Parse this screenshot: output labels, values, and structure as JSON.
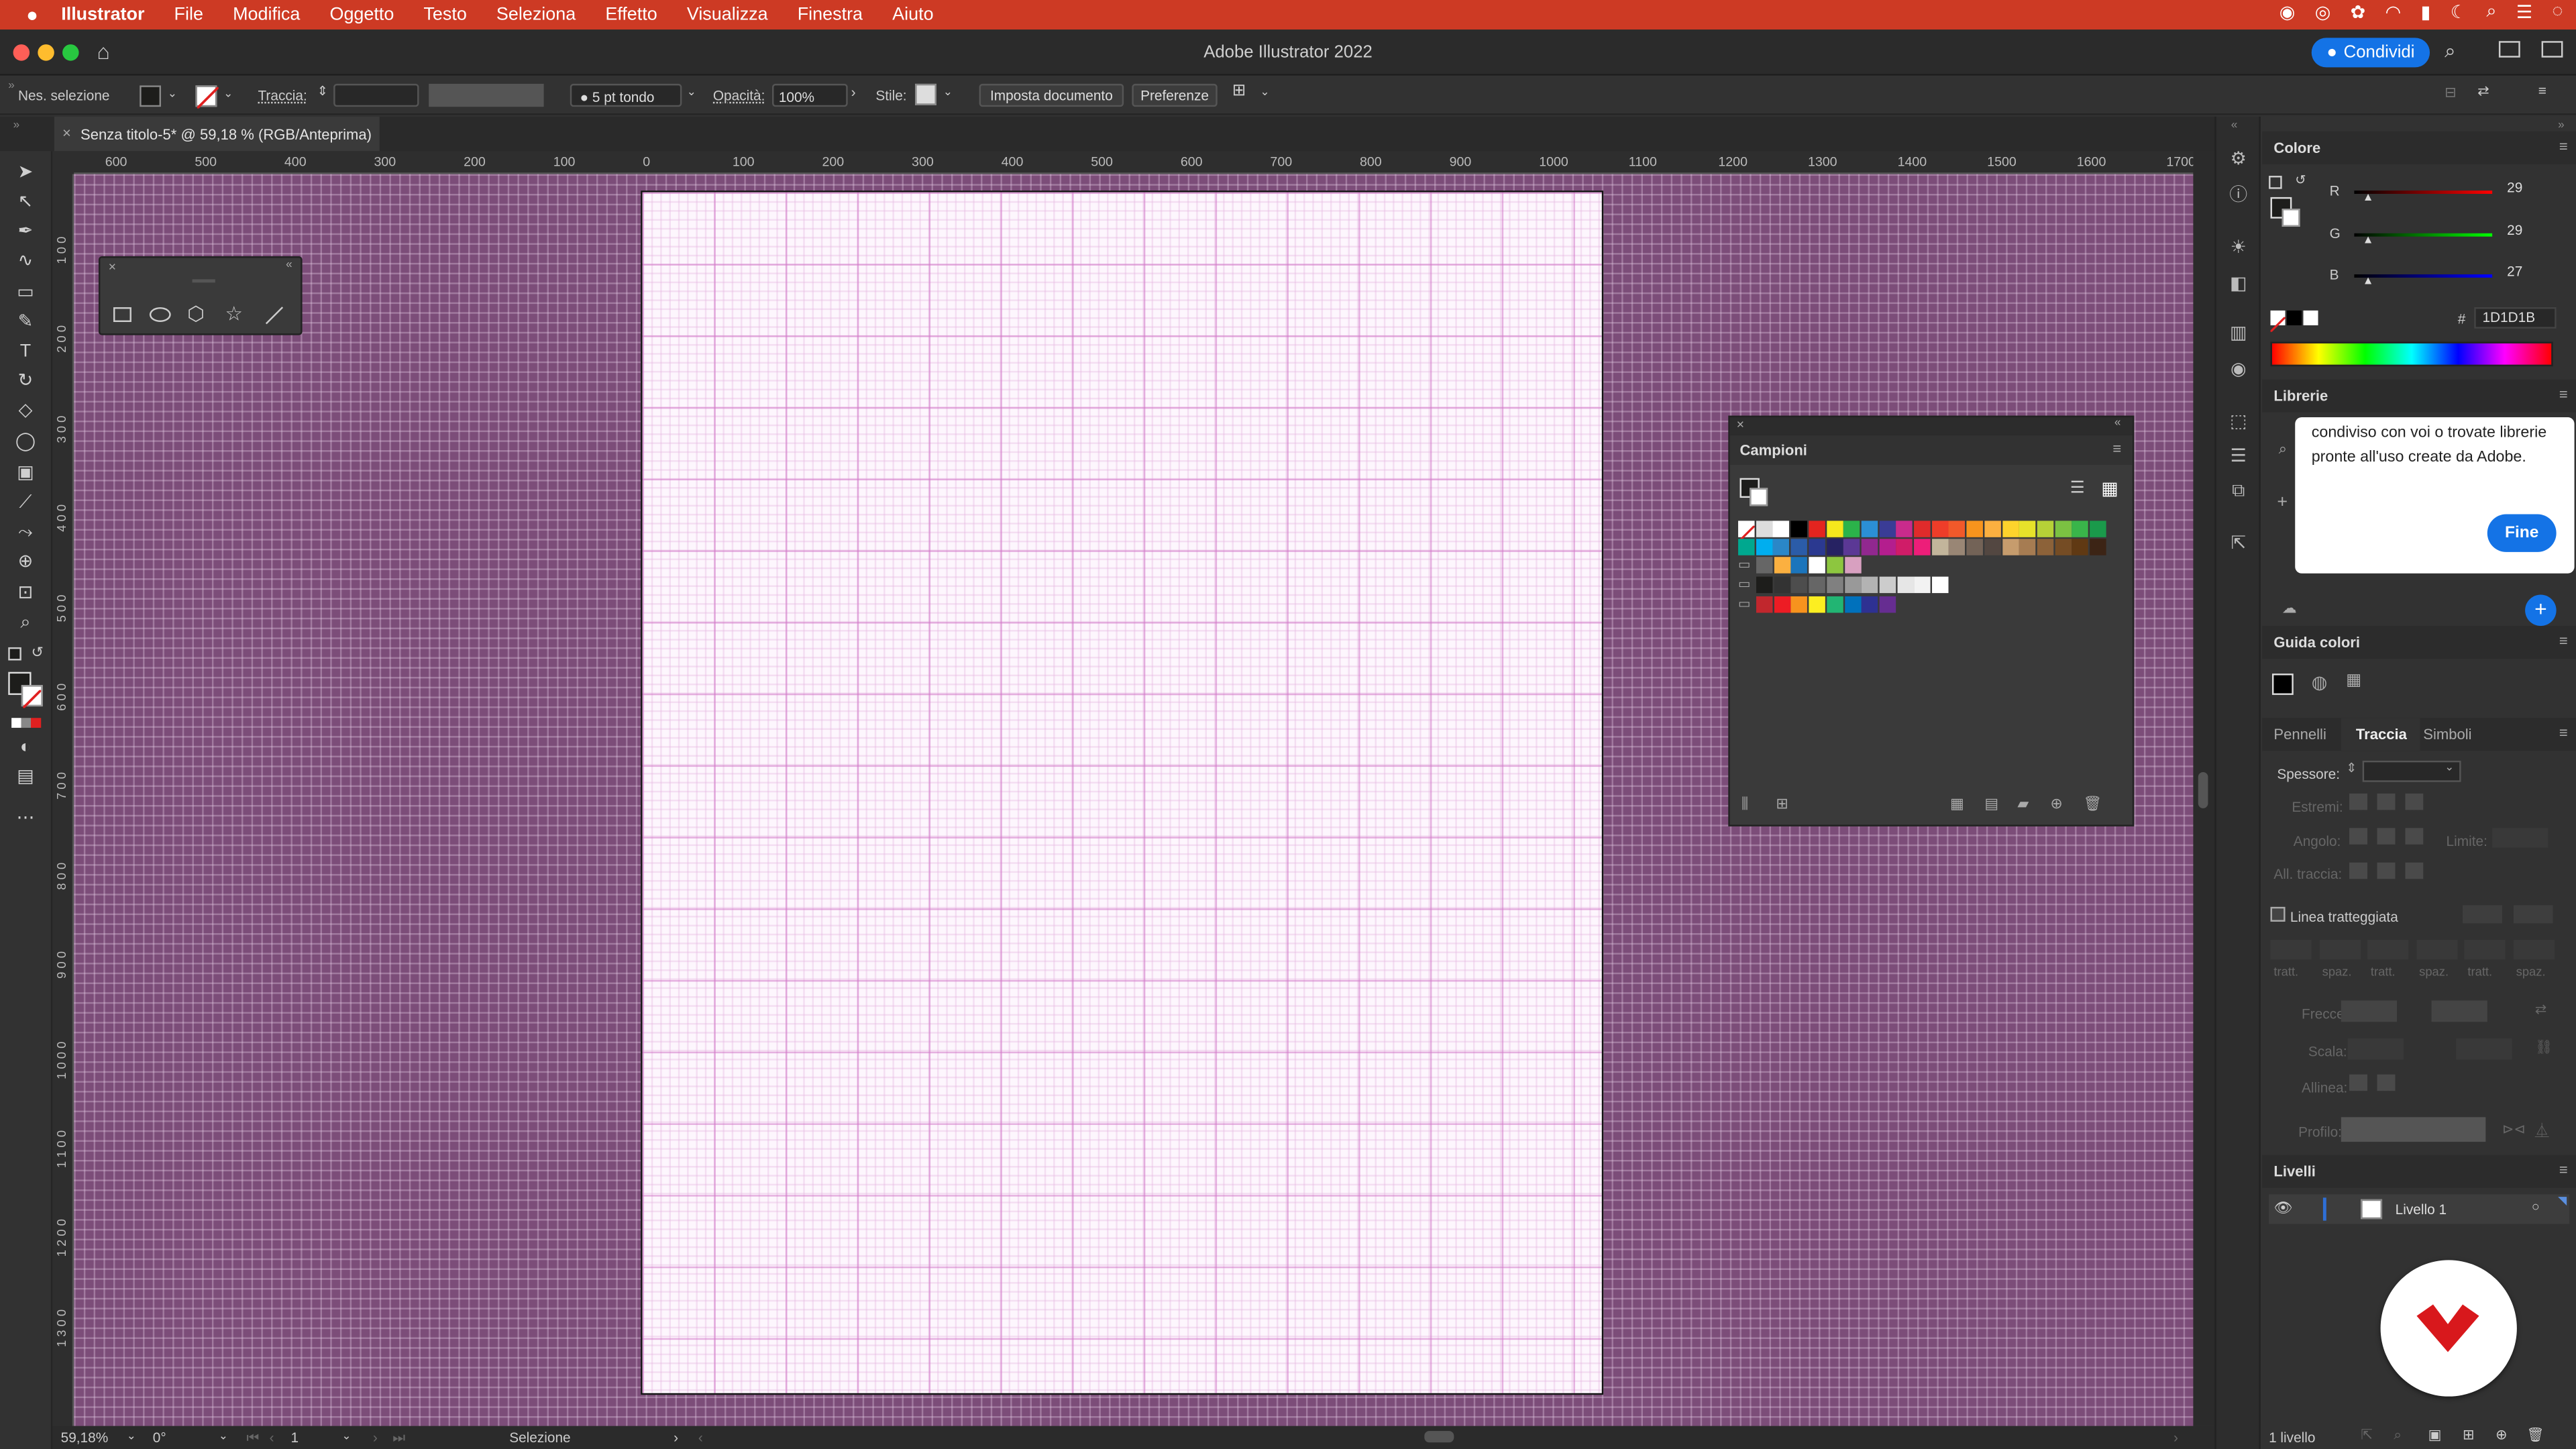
{
  "menubar": {
    "apple": "",
    "app": "Illustrator",
    "items": [
      "File",
      "Modifica",
      "Oggetto",
      "Testo",
      "Seleziona",
      "Effetto",
      "Visualizza",
      "Finestra",
      "Aiuto"
    ]
  },
  "titlebar": {
    "title": "Adobe Illustrator 2022",
    "share_label": "Condividi"
  },
  "control": {
    "selection": "Nes. selezione",
    "stroke_label": "Traccia:",
    "brush": "5 pt tondo",
    "opacity_label": "Opacità:",
    "opacity_value": "100%",
    "style_label": "Stile:",
    "doc_setup": "Imposta documento",
    "preferences": "Preferenze"
  },
  "document_tab": {
    "title": "Senza titolo-5* @ 59,18 % (RGB/Anteprima)",
    "close": "×"
  },
  "rulers": {
    "h_labels": [
      "600",
      "500",
      "400",
      "300",
      "200",
      "100",
      "0",
      "100",
      "200",
      "300",
      "400",
      "500",
      "600",
      "700",
      "800",
      "900",
      "1000",
      "1100",
      "1200",
      "1300",
      "1400",
      "1500",
      "1600",
      "1700"
    ],
    "v_labels": [
      "1 0 0",
      "2 0 0",
      "3 0 0",
      "4 0 0",
      "5 0 0",
      "6 0 0",
      "7 0 0",
      "8 0 0",
      "9 0 0",
      "1 0 0 0",
      "1 1 0 0",
      "1 2 0 0",
      "1 3 0 0"
    ]
  },
  "campioni": {
    "title": "Campioni"
  },
  "colore": {
    "title": "Colore",
    "r_label": "R",
    "r_value": "29",
    "g_label": "G",
    "g_value": "29",
    "b_label": "B",
    "b_value": "27",
    "hex_symbol": "#",
    "hex_value": "1D1D1B"
  },
  "librerie": {
    "title": "Librerie",
    "tooltip_text": "condiviso con voi o trovate librerie pronte all'uso create da Adobe.",
    "fine_label": "Fine"
  },
  "guida_colori": {
    "title": "Guida colori"
  },
  "stroke_panel": {
    "tabs": [
      "Pennelli",
      "Traccia",
      "Simboli"
    ],
    "spessore": "Spessore:",
    "estremi": "Estremi:",
    "angolo": "Angolo:",
    "limite": "Limite:",
    "all_traccia": "All. traccia:",
    "linea_tratteggiata": "Linea tratteggiata",
    "dash_labels": [
      "tratt.",
      "spaz.",
      "tratt.",
      "spaz.",
      "tratt.",
      "spaz."
    ],
    "frecce": "Frecce:",
    "scala": "Scala:",
    "allinea": "Allinea:",
    "profilo": "Profilo:"
  },
  "livelli": {
    "title": "Livelli",
    "layer_name": "Livello 1",
    "count": "1 livello"
  },
  "status": {
    "zoom": "59,18%",
    "rotation": "0°",
    "artboard": "1",
    "tool": "Selezione"
  },
  "colors": {
    "accent": "#1473e6",
    "menubar": "#cd3a24",
    "canvas_bg": "#7c4d79",
    "fill": "#1D1D1B",
    "logo_red": "#d8181c"
  }
}
